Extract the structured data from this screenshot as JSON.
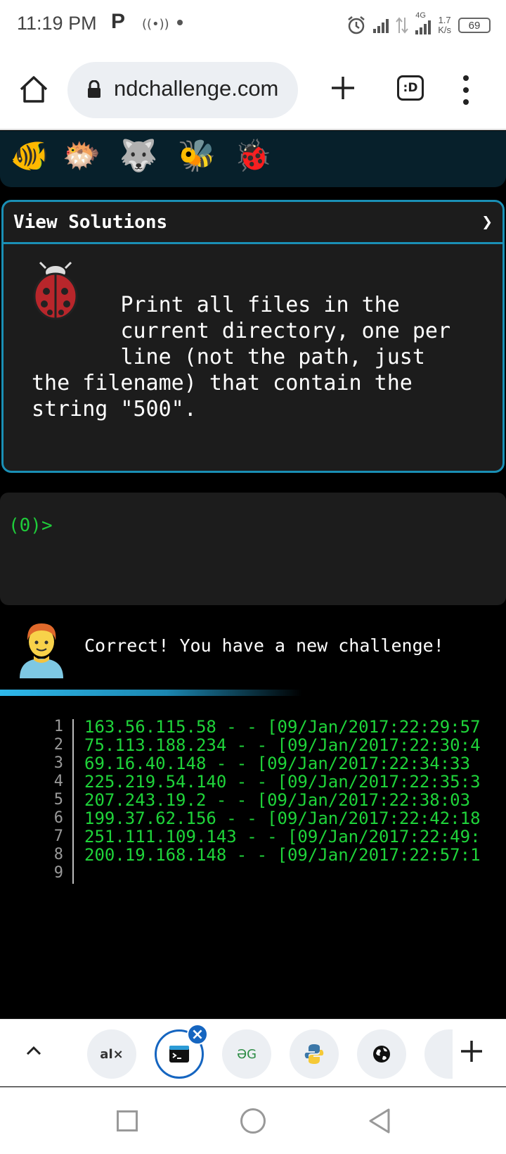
{
  "status_bar": {
    "time": "11:19 PM",
    "notif_glyph": "P",
    "network_type": "4G",
    "net_speed_value": "1.7",
    "net_speed_unit": "K/s",
    "battery": "69",
    "icons": [
      "alarm-icon",
      "signal-icon",
      "data-arrows-icon",
      "signal-4g-icon",
      "battery-icon"
    ]
  },
  "browser": {
    "url": "ndchallenge.com",
    "tabs_icon_label": ":D",
    "icons": [
      "home-icon",
      "lock-icon",
      "new-tab-plus-icon",
      "tab-switcher-icon",
      "overflow-menu-icon"
    ]
  },
  "avatars": [
    "🐠",
    "🐡",
    "🐺",
    "🐝",
    "🐞"
  ],
  "solutions": {
    "header": "View Solutions",
    "arrow": "❯",
    "challenge_icon": "ladybug-icon",
    "challenge_text": "       Print all files in the\n       current directory, one per\n       line (not the path, just\nthe filename) that contain the\nstring \"500\"."
  },
  "terminal": {
    "prompt": "(0)>"
  },
  "feedback": {
    "avatar_icon": "man-redhair-icon",
    "message": "Correct! You have a new challenge!",
    "accent": "#2fb8ea"
  },
  "output": {
    "lines": [
      {
        "n": "1",
        "text": "163.56.115.58 - - [09/Jan/2017:22:29:57"
      },
      {
        "n": "2",
        "text": "75.113.188.234 - - [09/Jan/2017:22:30:4"
      },
      {
        "n": "3",
        "text": "69.16.40.148 - - [09/Jan/2017:22:34:33"
      },
      {
        "n": "4",
        "text": "225.219.54.140 - - [09/Jan/2017:22:35:3"
      },
      {
        "n": "5",
        "text": "207.243.19.2 - - [09/Jan/2017:22:38:03"
      },
      {
        "n": "6",
        "text": "199.37.62.156 - - [09/Jan/2017:22:42:18"
      },
      {
        "n": "7",
        "text": "251.111.109.143 - - [09/Jan/2017:22:49:"
      },
      {
        "n": "8",
        "text": "200.19.168.148 - - [09/Jan/2017:22:57:1"
      },
      {
        "n": "9",
        "text": ""
      }
    ],
    "text_color": "#1fd43a"
  },
  "tab_strip": {
    "tabs": [
      {
        "label": "al×",
        "icon": "alx-tab-icon"
      },
      {
        "label": "",
        "icon": "terminal-tab-icon",
        "active": true
      },
      {
        "label": "ƏG",
        "icon": "geeksforgeeks-tab-icon"
      },
      {
        "label": "",
        "icon": "python-tab-icon"
      },
      {
        "label": "",
        "icon": "globe-tab-icon"
      }
    ],
    "icons": [
      "chevron-up-icon",
      "close-tab-icon",
      "add-tab-plus-icon"
    ]
  },
  "nav_bar": {
    "icons": [
      "recents-square-icon",
      "home-circle-icon",
      "back-triangle-icon"
    ]
  }
}
